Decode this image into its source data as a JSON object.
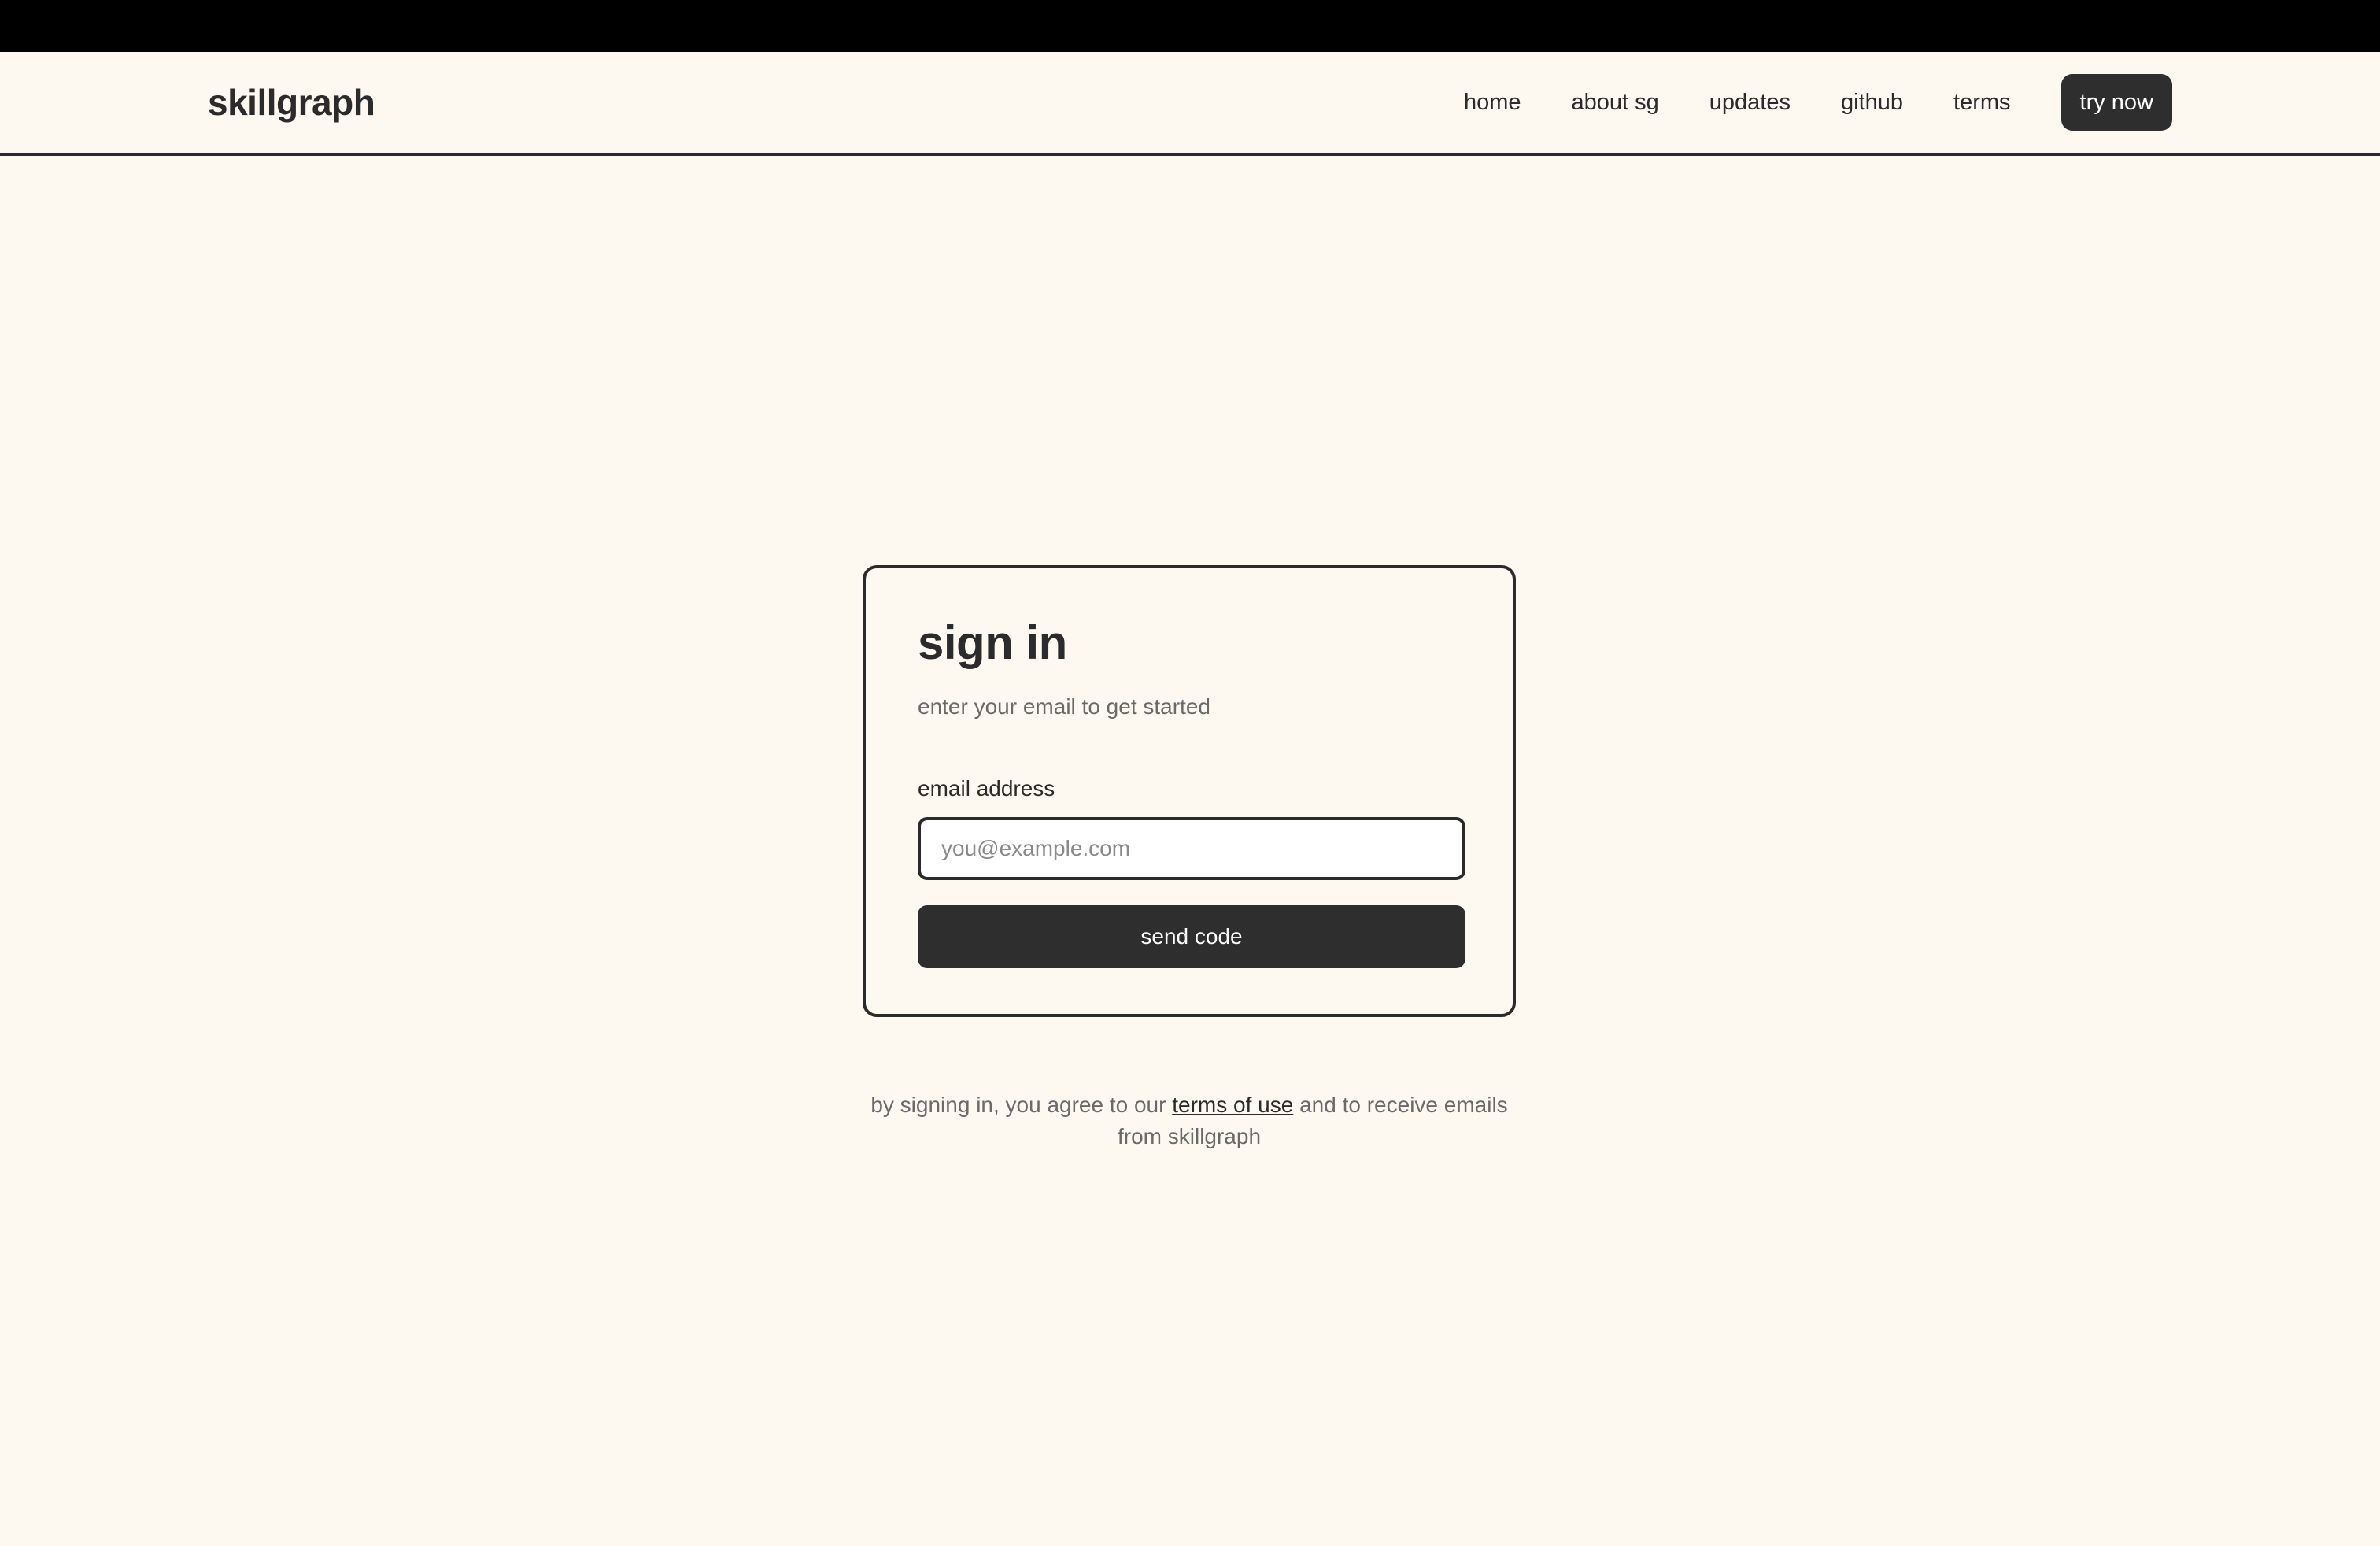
{
  "nav": {
    "brand": "skillgraph",
    "links": [
      "home",
      "about sg",
      "updates",
      "github",
      "terms"
    ],
    "cta_label": "try now"
  },
  "signin": {
    "title": "sign in",
    "subtitle": "enter your email to get started",
    "email_label": "email address",
    "email_placeholder": "you@example.com",
    "email_value": "",
    "submit_label": "send code"
  },
  "legal": {
    "prefix": "by signing in, you agree to our ",
    "link_text": "terms of use",
    "suffix": " and to receive emails from skillgraph"
  },
  "colors": {
    "background": "#fdf9f1",
    "ink": "#2b2b2b",
    "button": "#2e2e2e",
    "muted": "#6a6a6a"
  }
}
